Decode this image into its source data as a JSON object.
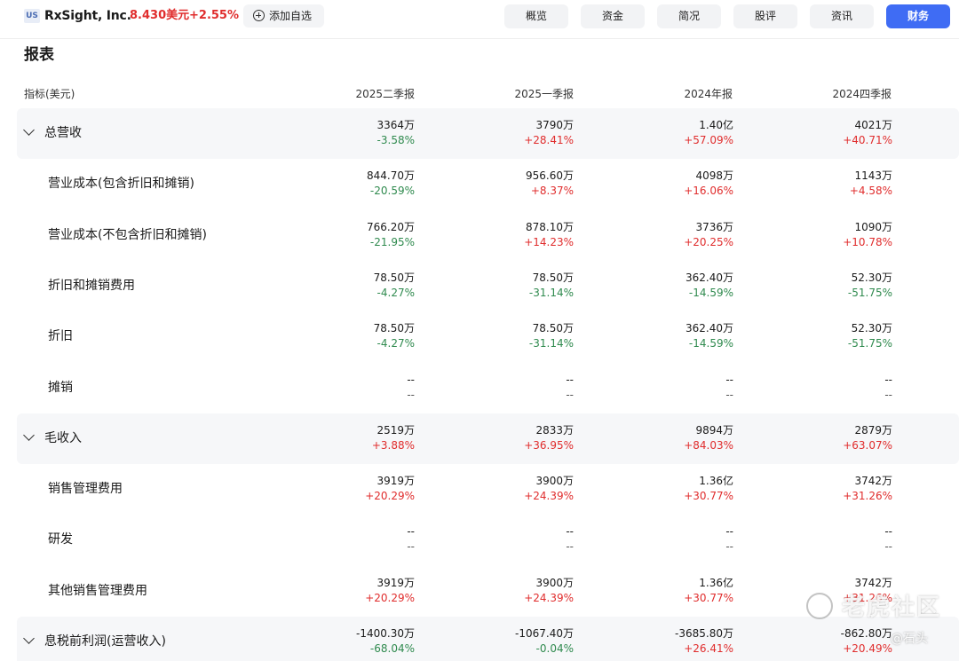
{
  "header": {
    "market": "US",
    "name": "RxSight, Inc.",
    "price": "8.430美元",
    "change": "+2.55%",
    "watch_label": "添加自选"
  },
  "nav": {
    "tabs": [
      {
        "label": "概览",
        "active": false
      },
      {
        "label": "资金",
        "active": false
      },
      {
        "label": "简况",
        "active": false
      },
      {
        "label": "股评",
        "active": false
      },
      {
        "label": "资讯",
        "active": false
      },
      {
        "label": "财务",
        "active": true
      }
    ]
  },
  "report": {
    "title": "报表",
    "metric_label": "指标(美元)",
    "columns": [
      "2025二季报",
      "2025一季报",
      "2024年报",
      "2024四季报"
    ],
    "rows": [
      {
        "label": "总营收",
        "group": true,
        "cells": [
          {
            "v": "3364万",
            "p": "-3.58%",
            "s": "neg"
          },
          {
            "v": "3790万",
            "p": "+28.41%",
            "s": "pos"
          },
          {
            "v": "1.40亿",
            "p": "+57.09%",
            "s": "pos"
          },
          {
            "v": "4021万",
            "p": "+40.71%",
            "s": "pos"
          }
        ]
      },
      {
        "label": "营业成本(包含折旧和摊销)",
        "group": false,
        "cells": [
          {
            "v": "844.70万",
            "p": "-20.59%",
            "s": "neg"
          },
          {
            "v": "956.60万",
            "p": "+8.37%",
            "s": "pos"
          },
          {
            "v": "4098万",
            "p": "+16.06%",
            "s": "pos"
          },
          {
            "v": "1143万",
            "p": "+4.58%",
            "s": "pos"
          }
        ]
      },
      {
        "label": "营业成本(不包含折旧和摊销)",
        "group": false,
        "cells": [
          {
            "v": "766.20万",
            "p": "-21.95%",
            "s": "neg"
          },
          {
            "v": "878.10万",
            "p": "+14.23%",
            "s": "pos"
          },
          {
            "v": "3736万",
            "p": "+20.25%",
            "s": "pos"
          },
          {
            "v": "1090万",
            "p": "+10.78%",
            "s": "pos"
          }
        ]
      },
      {
        "label": "折旧和摊销费用",
        "group": false,
        "cells": [
          {
            "v": "78.50万",
            "p": "-4.27%",
            "s": "neg"
          },
          {
            "v": "78.50万",
            "p": "-31.14%",
            "s": "neg"
          },
          {
            "v": "362.40万",
            "p": "-14.59%",
            "s": "neg"
          },
          {
            "v": "52.30万",
            "p": "-51.75%",
            "s": "neg"
          }
        ]
      },
      {
        "label": "折旧",
        "group": false,
        "cells": [
          {
            "v": "78.50万",
            "p": "-4.27%",
            "s": "neg"
          },
          {
            "v": "78.50万",
            "p": "-31.14%",
            "s": "neg"
          },
          {
            "v": "362.40万",
            "p": "-14.59%",
            "s": "neg"
          },
          {
            "v": "52.30万",
            "p": "-51.75%",
            "s": "neg"
          }
        ]
      },
      {
        "label": "摊销",
        "group": false,
        "cells": [
          {
            "v": "--",
            "p": "--",
            "s": "neu"
          },
          {
            "v": "--",
            "p": "--",
            "s": "neu"
          },
          {
            "v": "--",
            "p": "--",
            "s": "neu"
          },
          {
            "v": "--",
            "p": "--",
            "s": "neu"
          }
        ]
      },
      {
        "label": "毛收入",
        "group": true,
        "cells": [
          {
            "v": "2519万",
            "p": "+3.88%",
            "s": "pos"
          },
          {
            "v": "2833万",
            "p": "+36.95%",
            "s": "pos"
          },
          {
            "v": "9894万",
            "p": "+84.03%",
            "s": "pos"
          },
          {
            "v": "2879万",
            "p": "+63.07%",
            "s": "pos"
          }
        ]
      },
      {
        "label": "销售管理费用",
        "group": false,
        "cells": [
          {
            "v": "3919万",
            "p": "+20.29%",
            "s": "pos"
          },
          {
            "v": "3900万",
            "p": "+24.39%",
            "s": "pos"
          },
          {
            "v": "1.36亿",
            "p": "+30.77%",
            "s": "pos"
          },
          {
            "v": "3742万",
            "p": "+31.26%",
            "s": "pos"
          }
        ]
      },
      {
        "label": "研发",
        "group": false,
        "cells": [
          {
            "v": "--",
            "p": "--",
            "s": "neu"
          },
          {
            "v": "--",
            "p": "--",
            "s": "neu"
          },
          {
            "v": "--",
            "p": "--",
            "s": "neu"
          },
          {
            "v": "--",
            "p": "--",
            "s": "neu"
          }
        ]
      },
      {
        "label": "其他销售管理费用",
        "group": false,
        "cells": [
          {
            "v": "3919万",
            "p": "+20.29%",
            "s": "pos"
          },
          {
            "v": "3900万",
            "p": "+24.39%",
            "s": "pos"
          },
          {
            "v": "1.36亿",
            "p": "+30.77%",
            "s": "pos"
          },
          {
            "v": "3742万",
            "p": "+31.26%",
            "s": "pos"
          }
        ]
      },
      {
        "label": "息税前利润(运营收入)",
        "group": true,
        "cells": [
          {
            "v": "-1400.30万",
            "p": "-68.04%",
            "s": "neg"
          },
          {
            "v": "-1067.40万",
            "p": "-0.04%",
            "s": "neg"
          },
          {
            "v": "-3685.80万",
            "p": "+26.41%",
            "s": "pos"
          },
          {
            "v": "-862.80万",
            "p": "+20.49%",
            "s": "pos"
          }
        ]
      }
    ]
  },
  "colors": {
    "up": "#e02d2d",
    "down": "#2f8a4e",
    "accent": "#3f6cf4"
  },
  "watermark": {
    "brand": "老虎社区",
    "author": "@石头"
  }
}
